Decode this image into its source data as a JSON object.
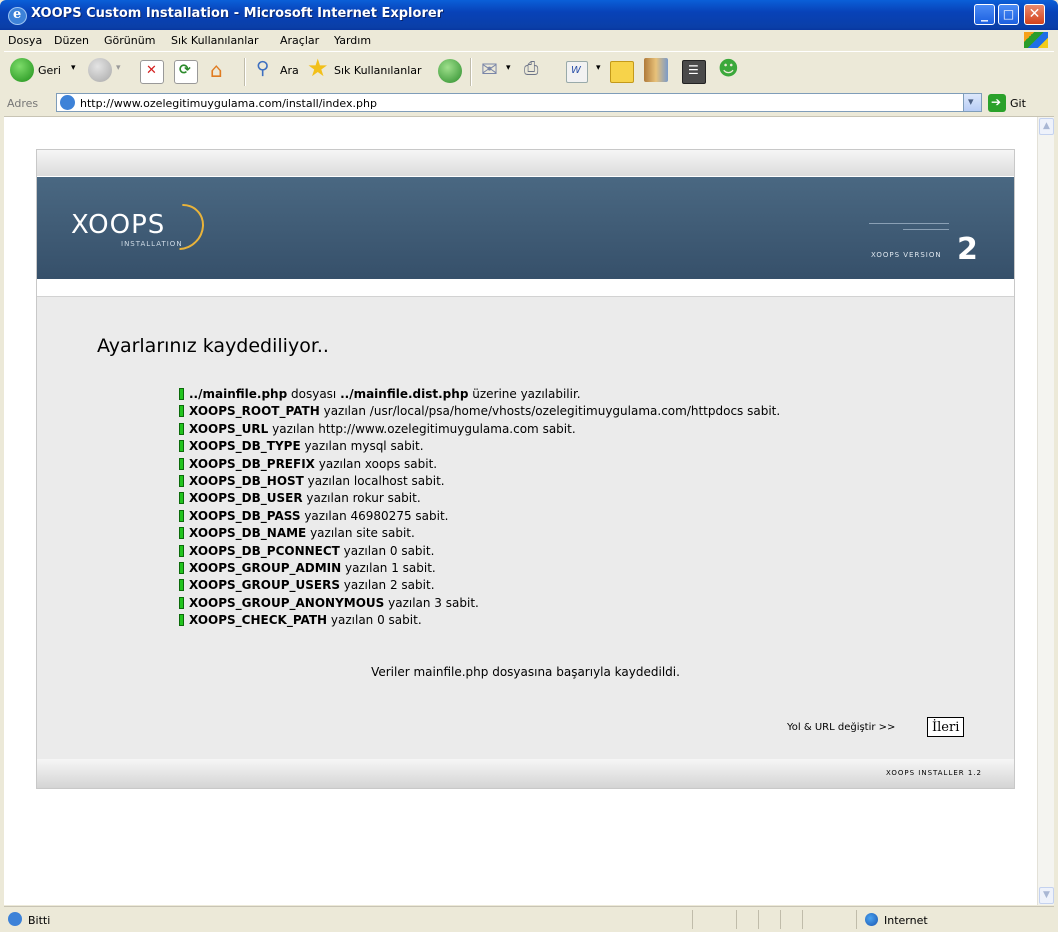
{
  "window": {
    "title": "XOOPS Custom Installation - Microsoft Internet Explorer",
    "minimize": "_",
    "maximize": "□",
    "close": "✕"
  },
  "menu": [
    "Dosya",
    "Düzen",
    "Görünüm",
    "Sık Kullanılanlar",
    "Araçlar",
    "Yardım"
  ],
  "toolbar": {
    "back_label": "Geri",
    "search_label": "Ara",
    "favorites_label": "Sık Kullanılanlar",
    "icons": [
      "back-icon",
      "forward-icon",
      "stop-icon",
      "refresh-icon",
      "home-icon",
      "search-icon",
      "favorites-icon",
      "history-icon",
      "mail-icon",
      "print-icon",
      "edit-icon",
      "discuss-icon",
      "research-icon",
      "messenger-icon"
    ]
  },
  "address": {
    "label": "Adres",
    "url": "http://www.ozelegitimuygulama.com/install/index.php",
    "go_label": "Git"
  },
  "installer": {
    "logo_text": "XOOPS",
    "logo_sub": "INSTALLATION",
    "version_text": "XOOPS VERSION",
    "version_number": "2",
    "heading": "Ayarlarınız kaydediliyor..",
    "items": [
      {
        "bold": "../mainfile.php",
        "text": " dosyası ",
        "bold2": "../mainfile.dist.php",
        "text2": " üzerine yazılabilir."
      },
      {
        "bold": "XOOPS_ROOT_PATH",
        "text": " yazılan /usr/local/psa/home/vhosts/ozelegitimuygulama.com/httpdocs sabit.",
        "bold2": "",
        "text2": ""
      },
      {
        "bold": "XOOPS_URL",
        "text": " yazılan http://www.ozelegitimuygulama.com sabit.",
        "bold2": "",
        "text2": ""
      },
      {
        "bold": "XOOPS_DB_TYPE",
        "text": " yazılan mysql sabit.",
        "bold2": "",
        "text2": ""
      },
      {
        "bold": "XOOPS_DB_PREFIX",
        "text": " yazılan xoops sabit.",
        "bold2": "",
        "text2": ""
      },
      {
        "bold": "XOOPS_DB_HOST",
        "text": " yazılan localhost sabit.",
        "bold2": "",
        "text2": ""
      },
      {
        "bold": "XOOPS_DB_USER",
        "text": " yazılan rokur sabit.",
        "bold2": "",
        "text2": ""
      },
      {
        "bold": "XOOPS_DB_PASS",
        "text": " yazılan 46980275 sabit.",
        "bold2": "",
        "text2": ""
      },
      {
        "bold": "XOOPS_DB_NAME",
        "text": " yazılan site sabit.",
        "bold2": "",
        "text2": ""
      },
      {
        "bold": "XOOPS_DB_PCONNECT",
        "text": " yazılan 0 sabit.",
        "bold2": "",
        "text2": ""
      },
      {
        "bold": "XOOPS_GROUP_ADMIN",
        "text": " yazılan 1 sabit.",
        "bold2": "",
        "text2": ""
      },
      {
        "bold": "XOOPS_GROUP_USERS",
        "text": " yazılan 2 sabit.",
        "bold2": "",
        "text2": ""
      },
      {
        "bold": "XOOPS_GROUP_ANONYMOUS",
        "text": " yazılan 3 sabit.",
        "bold2": "",
        "text2": ""
      },
      {
        "bold": "XOOPS_CHECK_PATH",
        "text": " yazılan 0 sabit.",
        "bold2": "",
        "text2": ""
      }
    ],
    "success": "Veriler mainfile.php dosyasına başarıyla kaydedildi.",
    "next_hint": "Yol & URL değiştir >>",
    "next_button": "İleri",
    "footer": "XOOPS INSTALLER 1.2"
  },
  "status": {
    "text": "Bitti",
    "zone": "Internet"
  },
  "colors": {
    "titlebar": "#0842b8",
    "banner": "#3d5a75",
    "status_ok": "#22c41e",
    "logo_accent": "#e9b33a"
  }
}
